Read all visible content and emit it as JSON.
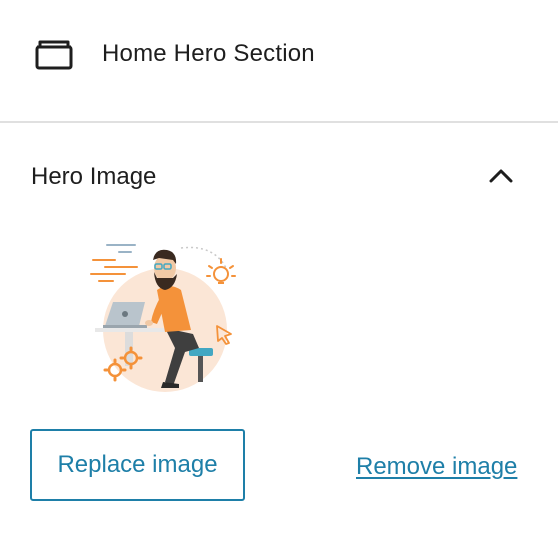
{
  "block": {
    "icon": "block-section-icon",
    "title": "Home Hero Section"
  },
  "panel": {
    "title": "Hero Image",
    "toggle_icon": "chevron-up-icon",
    "expanded": true
  },
  "image": {
    "alt": "Illustration of a bearded man working on a laptop with a lightbulb, gears and a cursor"
  },
  "actions": {
    "replace_label": "Replace image",
    "remove_label": "Remove image"
  },
  "colors": {
    "accent": "#1e7fa8",
    "divider": "#e0e0e0",
    "illustration_orange": "#f4923a",
    "text": "#1e1e1e"
  }
}
